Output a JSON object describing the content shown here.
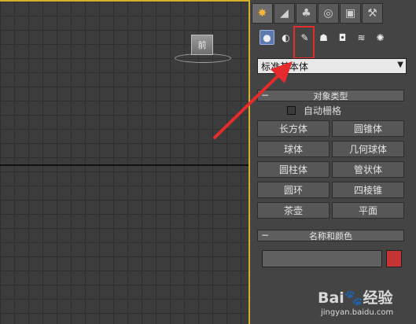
{
  "viewport": {
    "viewcube_label": "前",
    "border_color": "#d6b02a"
  },
  "main_tabs": [
    {
      "icon": "create-sun-icon",
      "glyph": "✸",
      "active": true
    },
    {
      "icon": "modify-curve-icon",
      "glyph": "◢",
      "active": false
    },
    {
      "icon": "hierarchy-icon",
      "glyph": "♣",
      "active": false
    },
    {
      "icon": "motion-icon",
      "glyph": "◎",
      "active": false
    },
    {
      "icon": "display-icon",
      "glyph": "▣",
      "active": false
    },
    {
      "icon": "utilities-hammer-icon",
      "glyph": "⚒",
      "active": false
    }
  ],
  "sub_icons": [
    {
      "icon": "geometry-sphere-icon",
      "glyph": "●",
      "active": true
    },
    {
      "icon": "shapes-icon",
      "glyph": "◐",
      "active": false
    },
    {
      "icon": "lights-icon",
      "glyph": "✎",
      "active": false
    },
    {
      "icon": "cameras-icon",
      "glyph": "☗",
      "active": false
    },
    {
      "icon": "helpers-icon",
      "glyph": "◘",
      "active": false
    },
    {
      "icon": "spacewarps-icon",
      "glyph": "≋",
      "active": false
    },
    {
      "icon": "systems-icon",
      "glyph": "✺",
      "active": false
    }
  ],
  "category_select": {
    "value": "标准基本体"
  },
  "object_type": {
    "title": "对象类型",
    "autogrid_label": "自动栅格",
    "buttons": [
      "长方体",
      "圆锥体",
      "球体",
      "几何球体",
      "圆柱体",
      "管状体",
      "圆环",
      "四棱锥",
      "茶壶",
      "平面"
    ]
  },
  "name_color": {
    "title": "名称和颜色",
    "name_value": "",
    "swatch_color": "#c53434"
  },
  "rollout_minus": "−",
  "annotation": {
    "color": "#e52b2b"
  },
  "watermark": {
    "logo": "Bai",
    "logo2": "经验",
    "url": "jingyan.baidu.com"
  }
}
